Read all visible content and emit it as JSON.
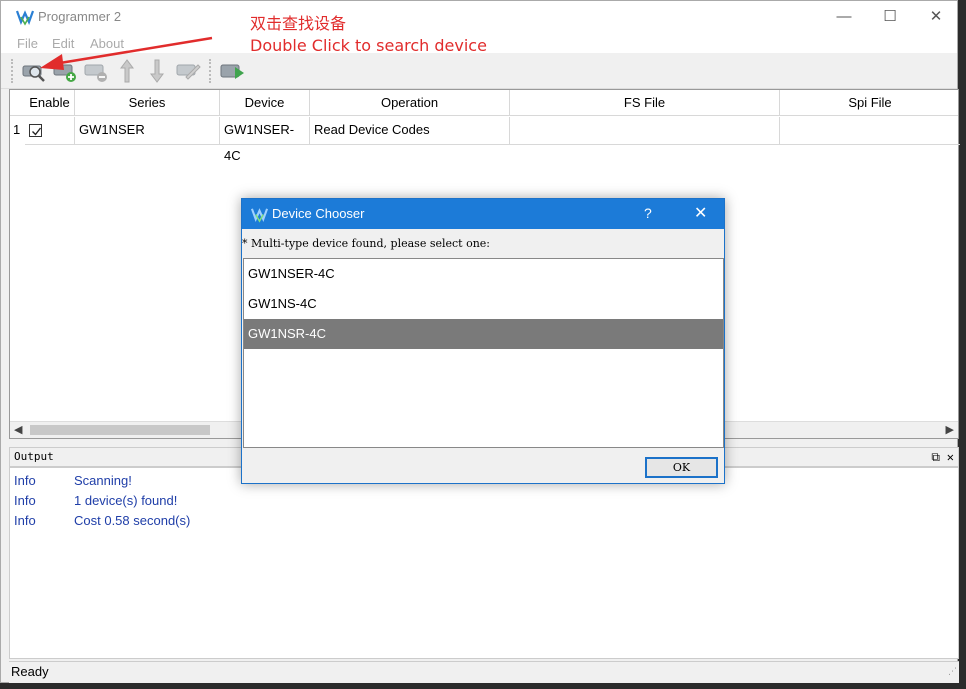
{
  "window": {
    "title": "Programmer 2",
    "controls": {
      "minimize": "—",
      "maximize": "☐",
      "close": "✕"
    }
  },
  "menu": [
    "File",
    "Edit",
    "About"
  ],
  "toolbar": {
    "buttons": [
      "scan-device-icon",
      "add-device-icon",
      "remove-device-icon",
      "move-up-icon",
      "move-down-icon",
      "edit-icon",
      "program-icon"
    ]
  },
  "annotation": {
    "line1": "双击查找设备",
    "line2": "Double Click to search device",
    "color": "#e12c2c"
  },
  "table": {
    "headers": [
      "Enable",
      "Series",
      "Device",
      "Operation",
      "FS File",
      "Spi File"
    ],
    "rows": [
      {
        "num": "1",
        "enabled": "☑",
        "series": "GW1NSER",
        "device": "GW1NSER-4C",
        "operation": "Read Device Codes",
        "fs_file": "",
        "spi_file": ""
      }
    ]
  },
  "output": {
    "title": "Output",
    "lines": [
      {
        "level": "Info",
        "message": "Scanning!"
      },
      {
        "level": "Info",
        "message": "1 device(s) found!"
      },
      {
        "level": "Info",
        "message": "Cost 0.58 second(s)"
      }
    ],
    "restore_icon": "⧉",
    "close_icon": "✕"
  },
  "status": {
    "text": "Ready"
  },
  "dialog": {
    "title": "Device Chooser",
    "help": "?",
    "close": "✕",
    "message": "* Multi-type device found, please select one:",
    "options": [
      "GW1NSER-4C",
      "GW1NS-4C",
      "GW1NSR-4C"
    ],
    "selected": "GW1NSR-4C",
    "ok_label": "OK"
  },
  "colors": {
    "accent": "#1c7bd8",
    "selection": "#7a7a7a",
    "log_text": "#1f3ea8"
  }
}
